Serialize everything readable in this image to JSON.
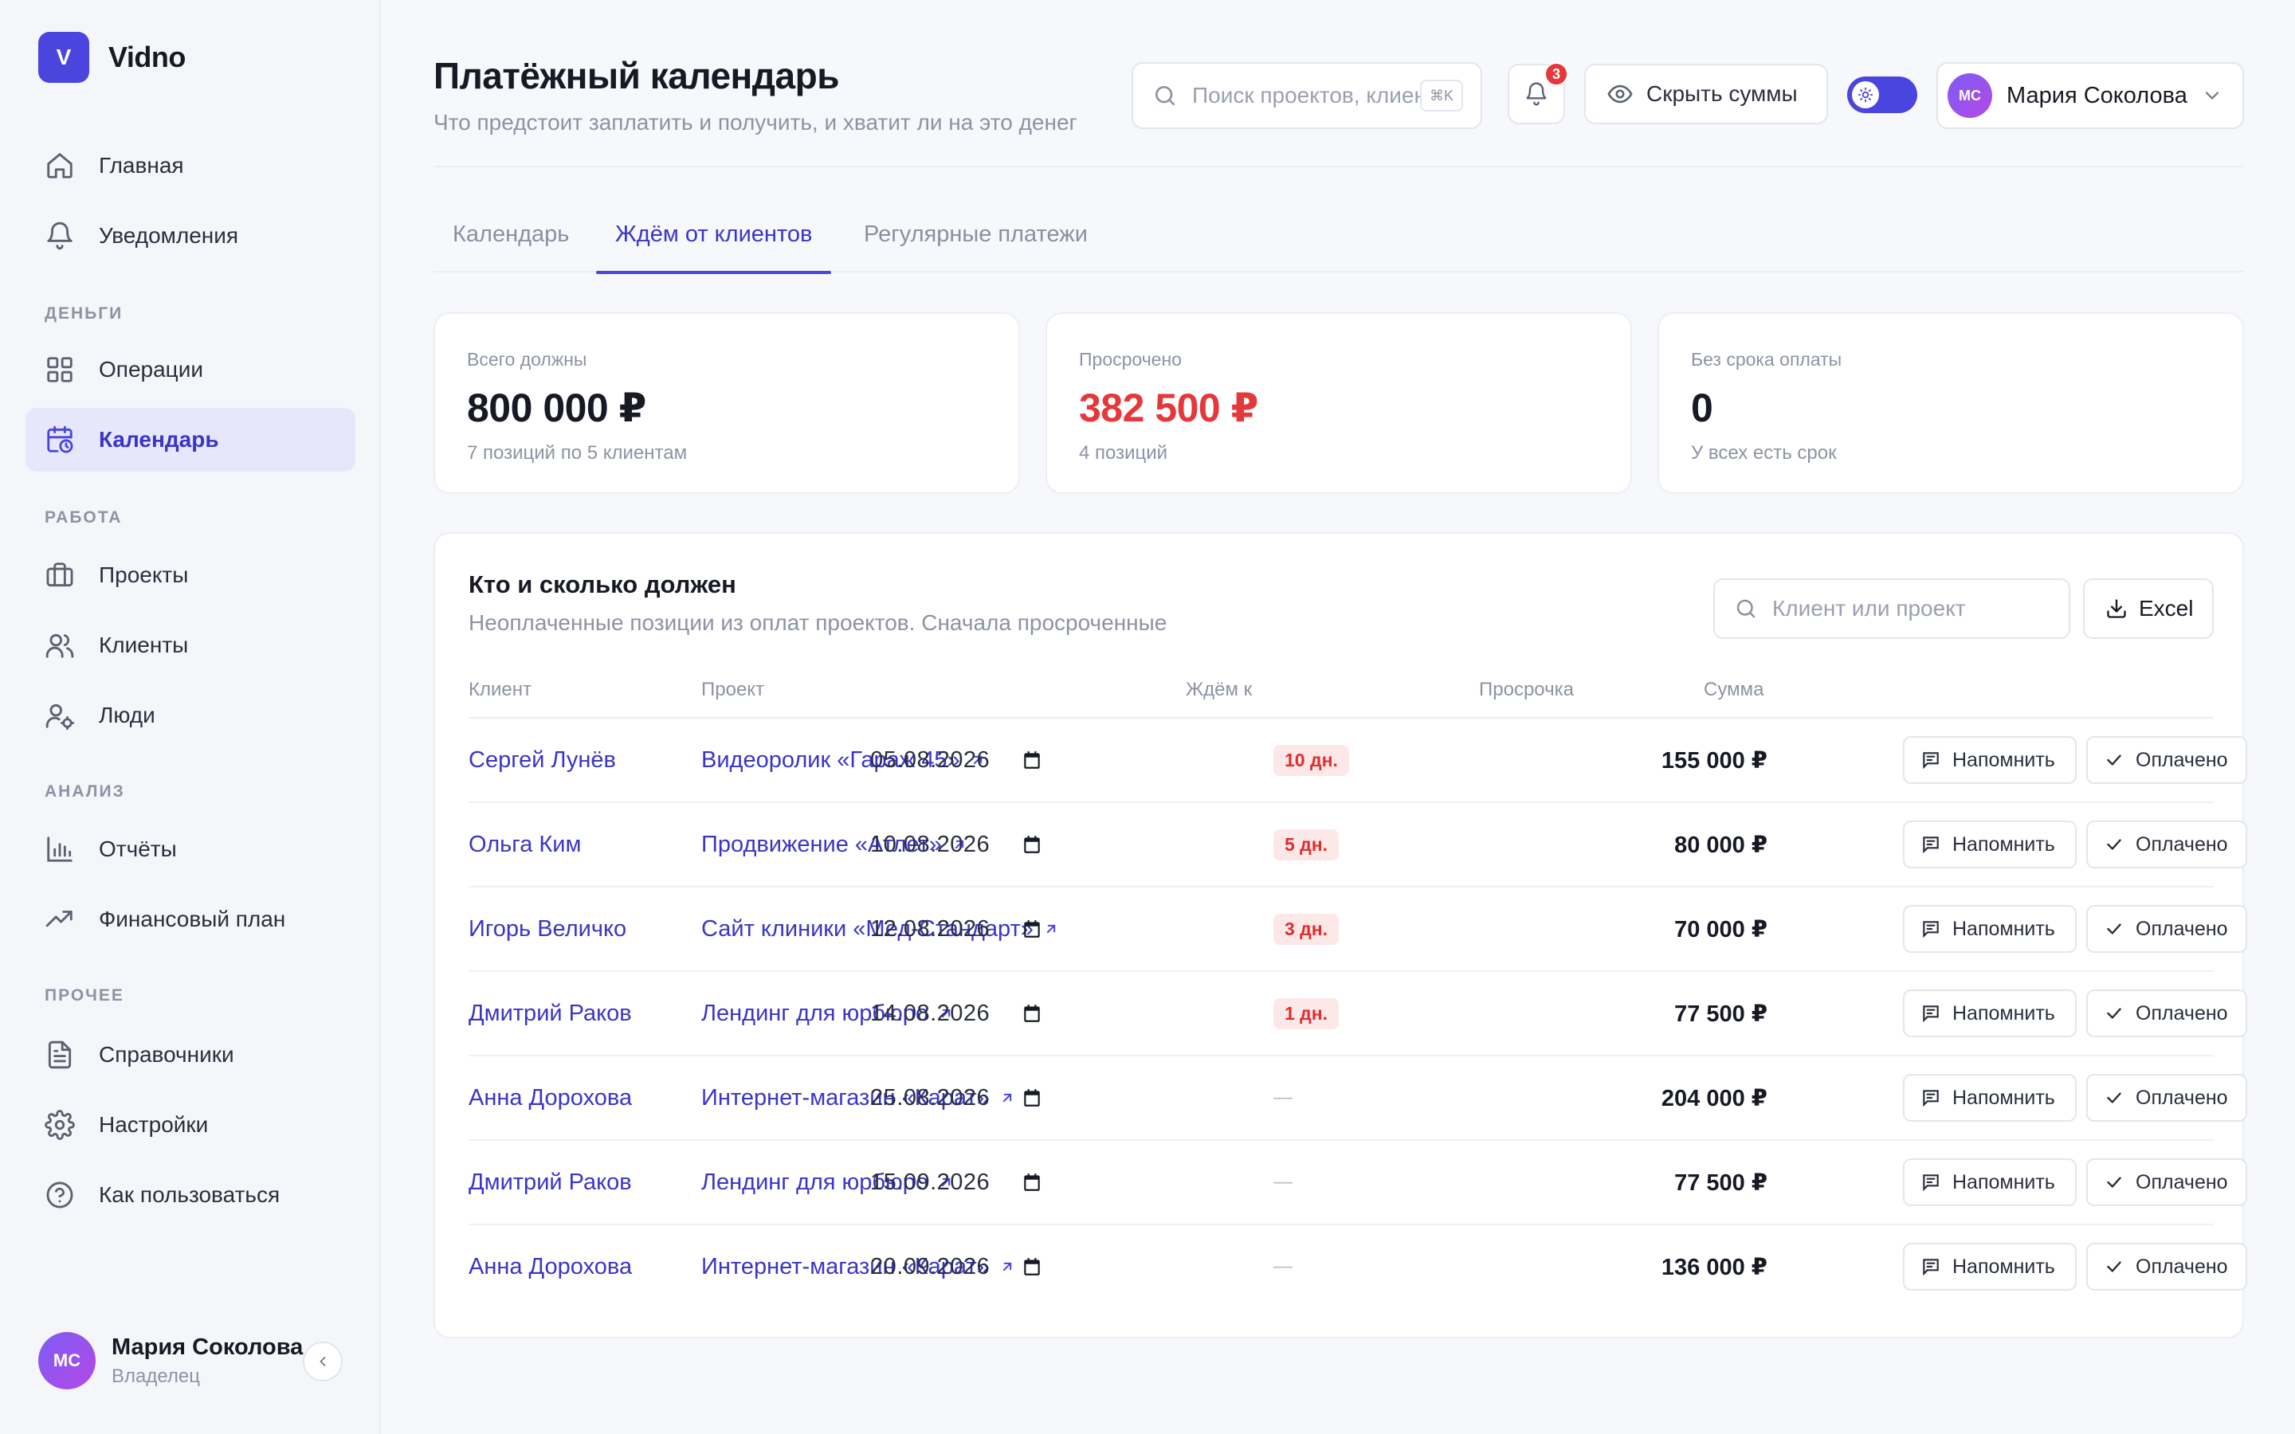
{
  "app": {
    "logo_letter": "V",
    "name": "Vidno"
  },
  "sidebar": {
    "items_main": [
      {
        "label": "Главная",
        "icon": "home-icon"
      },
      {
        "label": "Уведомления",
        "icon": "bell-icon"
      }
    ],
    "sections": {
      "money": "ДЕНЬГИ",
      "work": "РАБОТА",
      "analysis": "АНАЛИЗ",
      "other": "ПРОЧЕЕ"
    },
    "money_items": [
      {
        "label": "Операции",
        "icon": "grid-icon"
      },
      {
        "label": "Календарь",
        "icon": "calendar-clock-icon",
        "active": true
      }
    ],
    "work_items": [
      {
        "label": "Проекты",
        "icon": "briefcase-icon"
      },
      {
        "label": "Клиенты",
        "icon": "users-icon"
      },
      {
        "label": "Люди",
        "icon": "user-cog-icon"
      }
    ],
    "analysis_items": [
      {
        "label": "Отчёты",
        "icon": "bar-chart-icon"
      },
      {
        "label": "Финансовый план",
        "icon": "trending-up-icon"
      }
    ],
    "other_items": [
      {
        "label": "Справочники",
        "icon": "document-icon"
      },
      {
        "label": "Настройки",
        "icon": "gear-icon"
      },
      {
        "label": "Как пользоваться",
        "icon": "help-circle-icon"
      }
    ],
    "user": {
      "initials": "МС",
      "name": "Мария Соколова",
      "role": "Владелец"
    }
  },
  "header": {
    "title": "Платёжный календарь",
    "subtitle": "Что предстоит заплатить и получить, и хватит ли на это денег",
    "search_placeholder": "Поиск проектов, клиентов",
    "search_shortcut": "⌘K",
    "notifications_count": "3",
    "hide_sums_label": "Скрыть суммы",
    "user_initials": "МС",
    "user_name": "Мария Соколова"
  },
  "tabs": [
    {
      "label": "Календарь",
      "active": false
    },
    {
      "label": "Ждём от клиентов",
      "active": true
    },
    {
      "label": "Регулярные платежи",
      "active": false
    }
  ],
  "stats": [
    {
      "label": "Всего должны",
      "value": "800 000 ₽",
      "sub": "7 позиций по 5 клиентам",
      "tone": "normal"
    },
    {
      "label": "Просрочено",
      "value": "382 500 ₽",
      "sub": "4 позиций",
      "tone": "danger"
    },
    {
      "label": "Без срока оплаты",
      "value": "0",
      "sub": "У всех есть срок",
      "tone": "normal"
    }
  ],
  "table": {
    "title": "Кто и сколько должен",
    "subtitle": "Неоплаченные позиции из оплат проектов. Сначала просроченные",
    "search_placeholder": "Клиент или проект",
    "export_label": "Excel",
    "columns": {
      "client": "Клиент",
      "project": "Проект",
      "due": "Ждём к",
      "overdue": "Просрочка",
      "amount": "Сумма"
    },
    "remind_label": "Напомнить",
    "paid_label": "Оплачено",
    "rows": [
      {
        "client": "Сергей Лунёв",
        "project": "Видеоролик «Гараж 45»",
        "due": "05.08.2026",
        "overdue": "10 дн.",
        "amount": "155 000 ₽"
      },
      {
        "client": "Ольга Ким",
        "project": "Продвижение «Атлет»",
        "due": "10.08.2026",
        "overdue": "5 дн.",
        "amount": "80 000 ₽"
      },
      {
        "client": "Игорь Величко",
        "project": "Сайт клиники «Мед-Стандарт»",
        "due": "12.08.2026",
        "overdue": "3 дн.",
        "amount": "70 000 ₽"
      },
      {
        "client": "Дмитрий Раков",
        "project": "Лендинг для юрбюро",
        "due": "14.08.2026",
        "overdue": "1 дн.",
        "amount": "77 500 ₽"
      },
      {
        "client": "Анна Дорохова",
        "project": "Интернет-магазин «Карат»",
        "due": "25.08.2026",
        "overdue": "—",
        "amount": "204 000 ₽"
      },
      {
        "client": "Дмитрий Раков",
        "project": "Лендинг для юрбюро",
        "due": "15.09.2026",
        "overdue": "—",
        "amount": "77 500 ₽"
      },
      {
        "client": "Анна Дорохова",
        "project": "Интернет-магазин «Карат»",
        "due": "20.09.2026",
        "overdue": "—",
        "amount": "136 000 ₽"
      }
    ]
  },
  "colors": {
    "accent": "#4b45e0",
    "danger": "#e5383b",
    "muted": "#8d93a3"
  }
}
